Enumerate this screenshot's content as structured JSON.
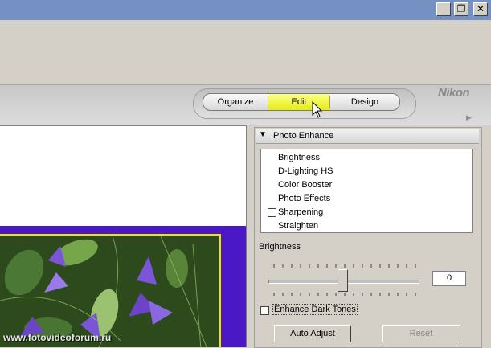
{
  "window": {
    "minimize_label": "_",
    "restore_label": "❐",
    "close_label": "✕"
  },
  "modes": {
    "items": [
      {
        "label": "Organize",
        "active": false
      },
      {
        "label": "Edit",
        "active": true
      },
      {
        "label": "Design",
        "active": false
      }
    ],
    "active_color": "#f0f43a"
  },
  "brand": {
    "logo_text": "Nikon"
  },
  "panel": {
    "title": "Photo Enhance",
    "tools": [
      {
        "label": "Brightness",
        "checkbox": false
      },
      {
        "label": "D-Lighting HS",
        "checkbox": false
      },
      {
        "label": "Color Booster",
        "checkbox": false
      },
      {
        "label": "Photo Effects",
        "checkbox": false
      },
      {
        "label": "Sharpening",
        "checkbox": true,
        "checked": false
      },
      {
        "label": "Straighten",
        "checkbox": false
      }
    ],
    "section_label": "Brightness",
    "brightness_value": "0",
    "slider_level": 0.5,
    "enhance_dark_tones_label": "Enhance Dark Tones",
    "enhance_dark_tones_checked": false,
    "auto_adjust_label": "Auto Adjust",
    "reset_label": "Reset"
  },
  "watermark": "www.fotovideoforum.ru",
  "colors": {
    "titlebar": "#7591c4",
    "photo_backdrop": "#4a18c4",
    "photo_border": "#e8e800"
  }
}
